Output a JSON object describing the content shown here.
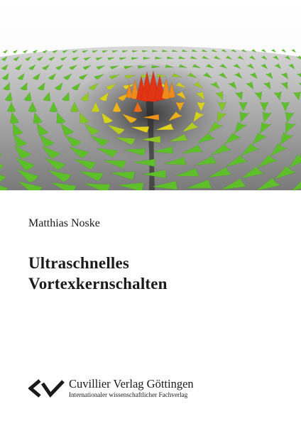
{
  "cover": {
    "author": "Matthias Noske",
    "title_line1": "Ultraschnelles",
    "title_line2": "Vortexkernschalten"
  },
  "publisher": {
    "logo_icon": "cuvillier-logo-icon",
    "name": "Cuvillier Verlag Göttingen",
    "tagline": "Internationaler wissenschaftlicher Fachverlag"
  },
  "colors": {
    "text": "#1a1a1a",
    "cone_green": "#5fbf2a",
    "cone_yellow": "#e8d51a",
    "cone_orange": "#f08a1c",
    "cone_red": "#e03414",
    "surface_grey": "#9a9a9a"
  }
}
